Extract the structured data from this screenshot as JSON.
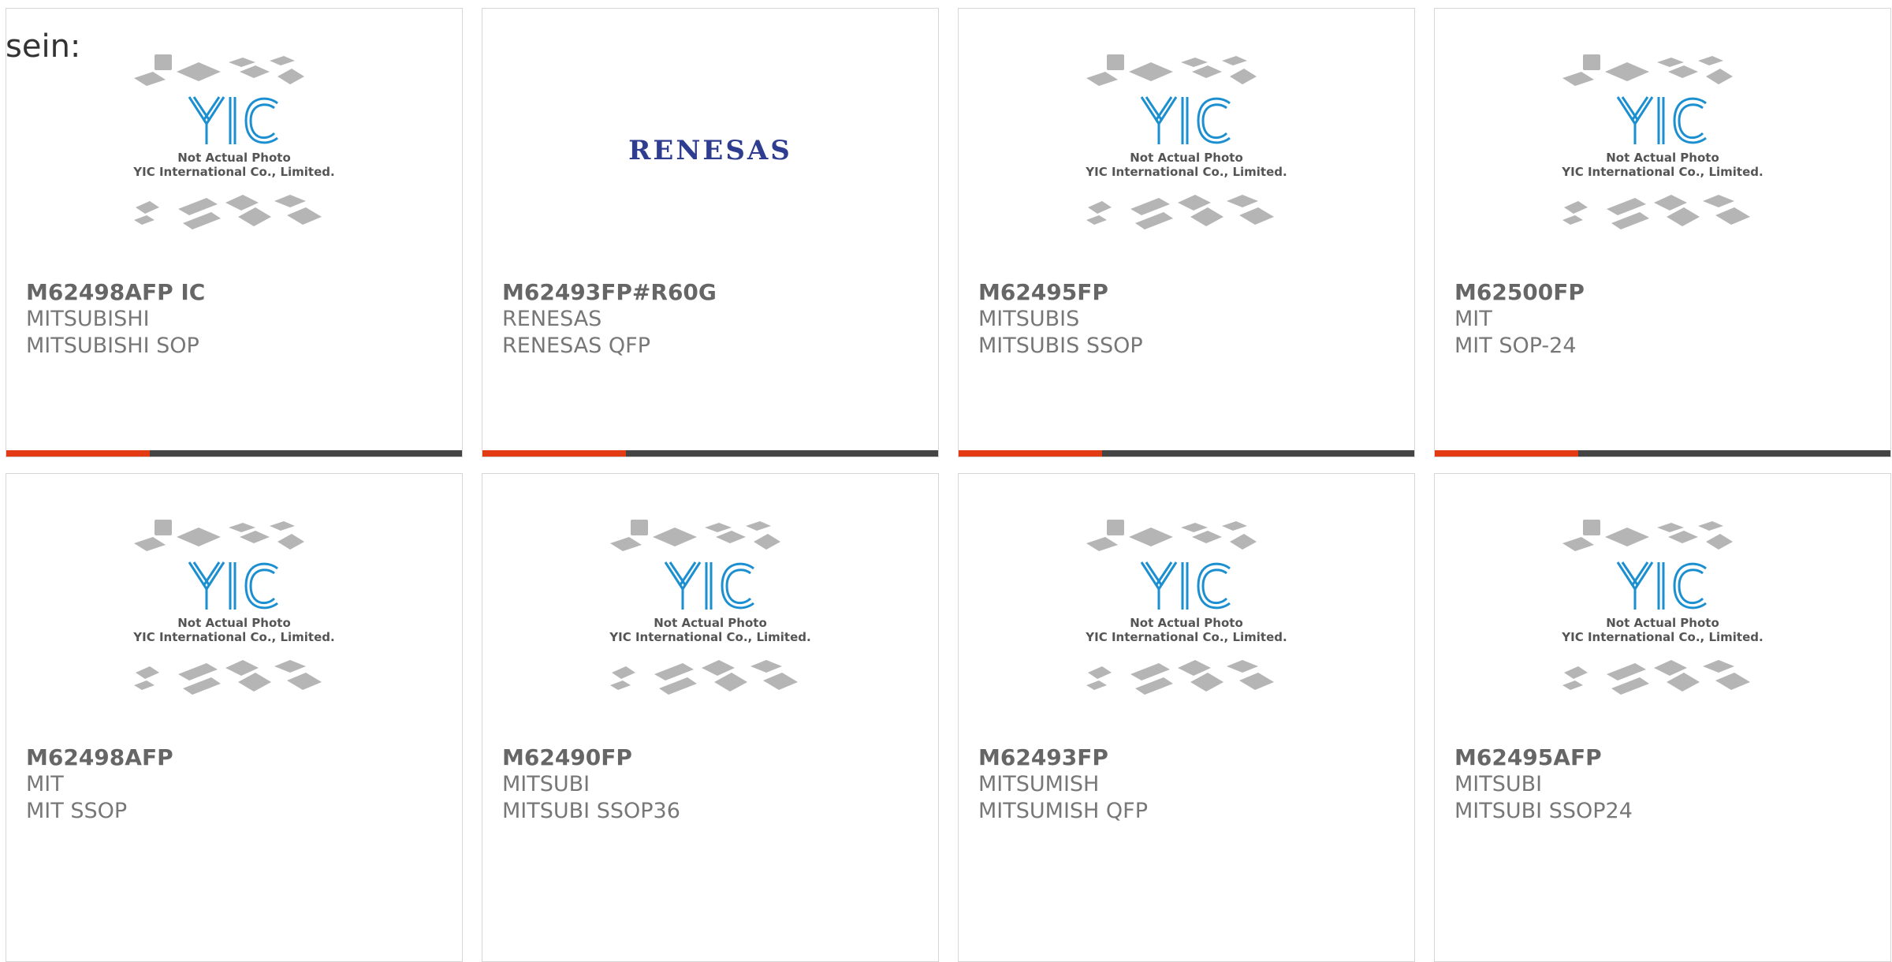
{
  "lead_text": "sein:",
  "placeholder": {
    "line1": "Not Actual Photo",
    "line2": "YIC International Co., Limited.",
    "logo": "YIC"
  },
  "products": [
    {
      "name": "M62498AFP IC",
      "brand": "MITSUBISHI",
      "package": "MITSUBISHI SOP",
      "image": "placeholder"
    },
    {
      "name": "M62493FP#R60G",
      "brand": "RENESAS",
      "package": "RENESAS QFP",
      "image": "renesas-logo",
      "logo_text": "RENESAS"
    },
    {
      "name": "M62495FP",
      "brand": "MITSUBIS",
      "package": "MITSUBIS SSOP",
      "image": "placeholder"
    },
    {
      "name": "M62500FP",
      "brand": "MIT",
      "package": "MIT SOP-24",
      "image": "placeholder"
    },
    {
      "name": "M62498AFP",
      "brand": "MIT",
      "package": "MIT SSOP",
      "image": "placeholder"
    },
    {
      "name": "M62490FP",
      "brand": "MITSUBI",
      "package": "MITSUBI SSOP36",
      "image": "placeholder"
    },
    {
      "name": "M62493FP",
      "brand": "MITSUMISH",
      "package": "MITSUMISH QFP",
      "image": "placeholder"
    },
    {
      "name": "M62495AFP",
      "brand": "MITSUBI",
      "package": "MITSUBI SSOP24",
      "image": "placeholder"
    }
  ],
  "colors": {
    "accent_bar": "#e23a12",
    "bar_dark": "#444444",
    "logo_blue": "#1b8fd0",
    "renesas_blue": "#2e3d8f"
  }
}
